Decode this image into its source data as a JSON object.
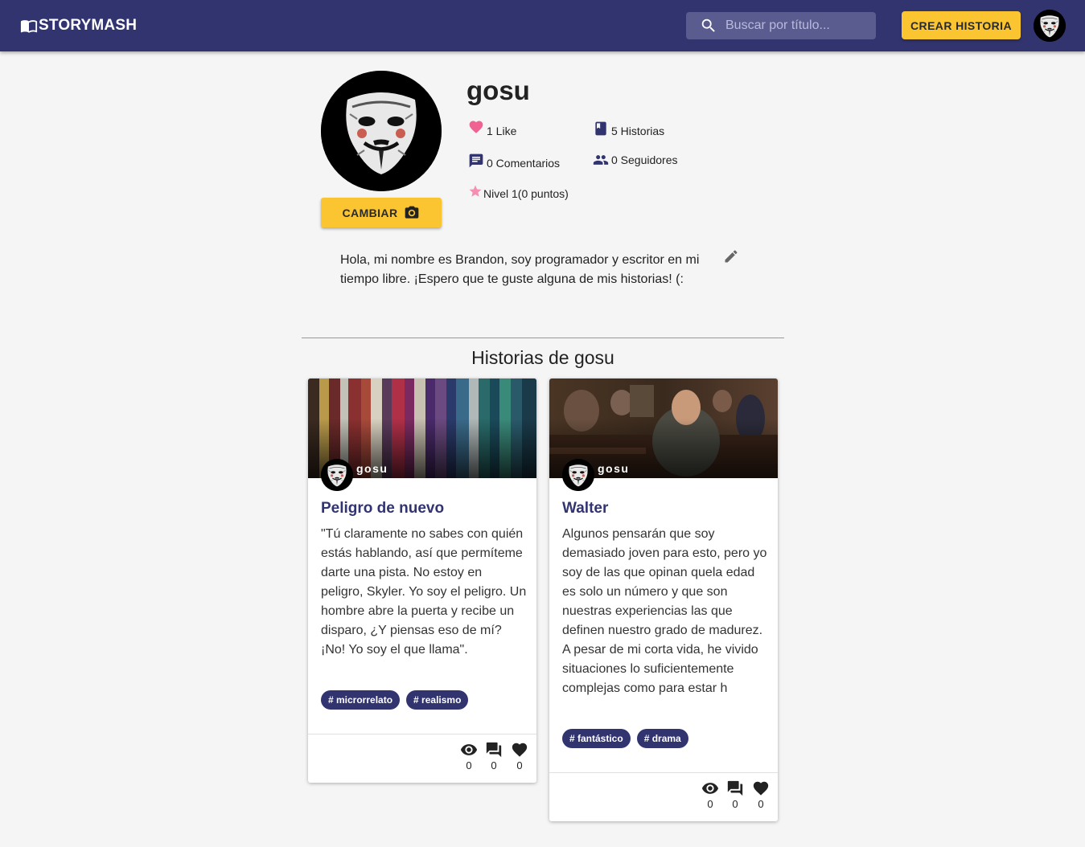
{
  "header": {
    "brand": "STORYMASH",
    "search_placeholder": "Buscar por título...",
    "create_label": "CREAR HISTORIA"
  },
  "profile": {
    "username": "gosu",
    "change_label": "CAMBIAR",
    "likes": "1 Like",
    "stories": "5 Historias",
    "comments": "0 Comentarios",
    "followers": "0 Seguidores",
    "level": "Nivel 1(0 puntos)",
    "bio": "Hola, mi nombre es Brandon, soy programador y escritor en mi tiempo libre. ¡Espero que te guste alguna de mis historias! (:"
  },
  "section_title": "Historias de gosu",
  "stories": [
    {
      "author": "gosu",
      "title": "Peligro de nuevo",
      "excerpt": "\"Tú claramente no sabes con quién estás hablando, así que permíteme darte una pista. No estoy en peligro, Skyler. Yo soy el peligro. Un hombre abre la puerta y recibe un disparo, ¿Y piensas eso de mí? ¡No! Yo soy el que llama\".",
      "tags": [
        "# microrrelato",
        "# realismo"
      ],
      "views": "0",
      "comments": "0",
      "likes": "0"
    },
    {
      "author": "gosu",
      "title": "Walter",
      "excerpt": "Algunos pensarán que soy demasiado joven para esto, pero yo soy de las que opinan quela edad es solo un número y que son nuestras experiencias las que definen nuestro grado de madurez. A pesar de mi corta vida, he vivido situaciones lo suficientemente complejas como para estar h",
      "tags": [
        "# fantástico",
        "# drama"
      ],
      "views": "0",
      "comments": "0",
      "likes": "0"
    }
  ],
  "colors": {
    "primary": "#323470",
    "accent": "#fbc531",
    "like_pink": "#f06292",
    "star_pink": "#f48fb1"
  },
  "icons": [
    "book-open-icon",
    "search-icon",
    "camera-icon",
    "heart-icon",
    "book-icon",
    "comment-icon",
    "people-icon",
    "star-icon",
    "pencil-icon",
    "eye-icon",
    "forum-icon"
  ]
}
